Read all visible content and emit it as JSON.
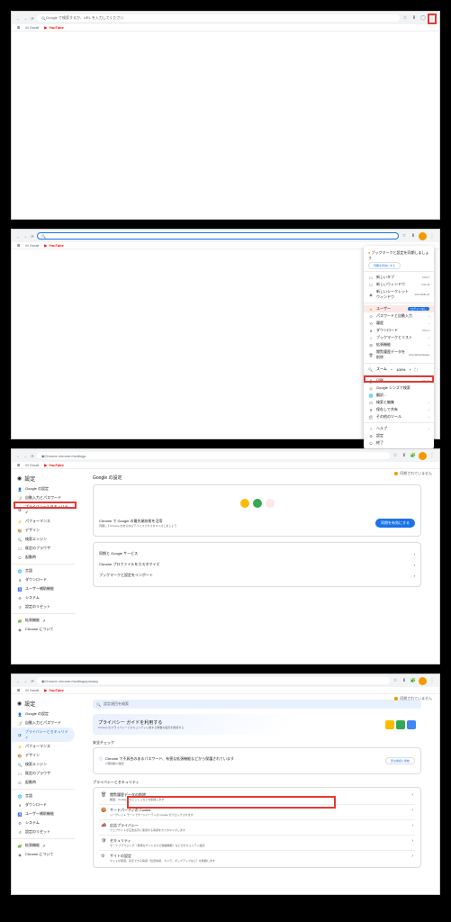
{
  "p1": {
    "omnibox": "Google で検索するか、URL を入力してください",
    "bookmarks": {
      "gmail": "M Gmail",
      "youtube": "YouTube"
    }
  },
  "p2": {
    "omnibox": "",
    "menu": {
      "header": "ブックマークと設定を同期しましょう",
      "sync_btn": "同期を有効にする",
      "new_tab": "新しいタブ",
      "new_window": "新しいウィンドウ",
      "incognito": "新しいシークレット ウィンドウ",
      "incognito_sc": "Ctrl+Shift+N",
      "profile": "ユーザー",
      "profile_badge": "ログインなし",
      "passwords": "パスワードと自動入力",
      "history": "履歴",
      "downloads": "ダウンロード",
      "bookmarks": "ブックマークとリスト",
      "extensions": "拡張機能",
      "clear_data": "閲覧履歴データを削除",
      "clear_data_sc": "Ctrl+Shift+Delete",
      "zoom": "ズーム",
      "zoom_val": "100%",
      "print": "印刷...",
      "cast": "Google レンズで検索",
      "translate": "翻訳...",
      "find": "検索と編集",
      "save": "保存して共有",
      "more_tools": "その他のツール",
      "help": "ヘルプ",
      "settings": "設定",
      "exit": "終了"
    }
  },
  "p3": {
    "url": "Chrome  chrome://settings",
    "title": "設定",
    "sidebar": {
      "google": "Google の設定",
      "autofill": "自動入力とパスワード",
      "privacy": "プライバシーとセキュリティ",
      "performance": "パフォーマンス",
      "appearance": "デザイン",
      "search": "検索エンジン",
      "default": "既定のブラウザ",
      "startup": "起動時",
      "languages": "言語",
      "downloads": "ダウンロード",
      "a11y": "ユーザー補助機能",
      "system": "システム",
      "reset": "設定のリセット",
      "ext": "拡張機能",
      "about": "Chrome について"
    },
    "main": {
      "section": "Google の設定",
      "sync_title": "Chrome で Google の最先端技術を活用",
      "sync_desc": "同期してChrome をあらゆるデバイスでカスタマイズしましょう",
      "sync_btn": "同期を有効にする",
      "row1": "同期と Google サービス",
      "row2": "Chrome プロファイルをカスタマイズ",
      "row3": "ブックマークと設定をインポート"
    },
    "sync_status": "同期されていません"
  },
  "p4": {
    "url": "Chrome  chrome://settings/privacy",
    "title": "設定",
    "search_ph": "設定項目を検索",
    "sidebar": {
      "google": "Google の設定",
      "autofill": "自動入力とパスワード",
      "privacy": "プライバシーとセキュリティ",
      "performance": "パフォーマンス",
      "appearance": "デザイン",
      "search": "検索エンジン",
      "default": "既定のブラウザ",
      "startup": "起動時",
      "languages": "言語",
      "downloads": "ダウンロード",
      "a11y": "ユーザー補助機能",
      "system": "システム",
      "reset": "設定のリセット",
      "ext": "拡張機能",
      "about": "Chrome について"
    },
    "main": {
      "pg_title": "プライバシー ガイドを利用する",
      "pg_sub": "Chrome のプライバシーとセキュリティに関する重要な設定を確認する",
      "check_title": "安全チェック",
      "check_row": "Chrome で不具合のあるパスワード、有害な拡張機能などから保護されています",
      "check_sub": "2 時間前に確認",
      "check_btn": "安全確認に移動",
      "sec_title": "プライバシーとセキュリティ",
      "r1_t": "閲覧履歴データの削除",
      "r1_s": "履歴、Cookie、キャッシュなどを削除します",
      "r2_t": "サードパーティの Cookie",
      "r2_s": "シークレット モードでサードパーティの Cookie がブロックされます",
      "r3_t": "広告プライバシー",
      "r3_s": "ウェブサイトが広告表示に使用する情報をカスタマイズします",
      "r4_t": "セキュリティ",
      "r4_s": "セーフ ブラウジング（危険なサイトからの保護機能）などのセキュリティ設定",
      "r5_t": "サイトの設定",
      "r5_s": "サイトが使用、表示できる情報（位置情報、カメラ、ポップアップなど）を制御します"
    },
    "sync_status": "同期されていません"
  }
}
